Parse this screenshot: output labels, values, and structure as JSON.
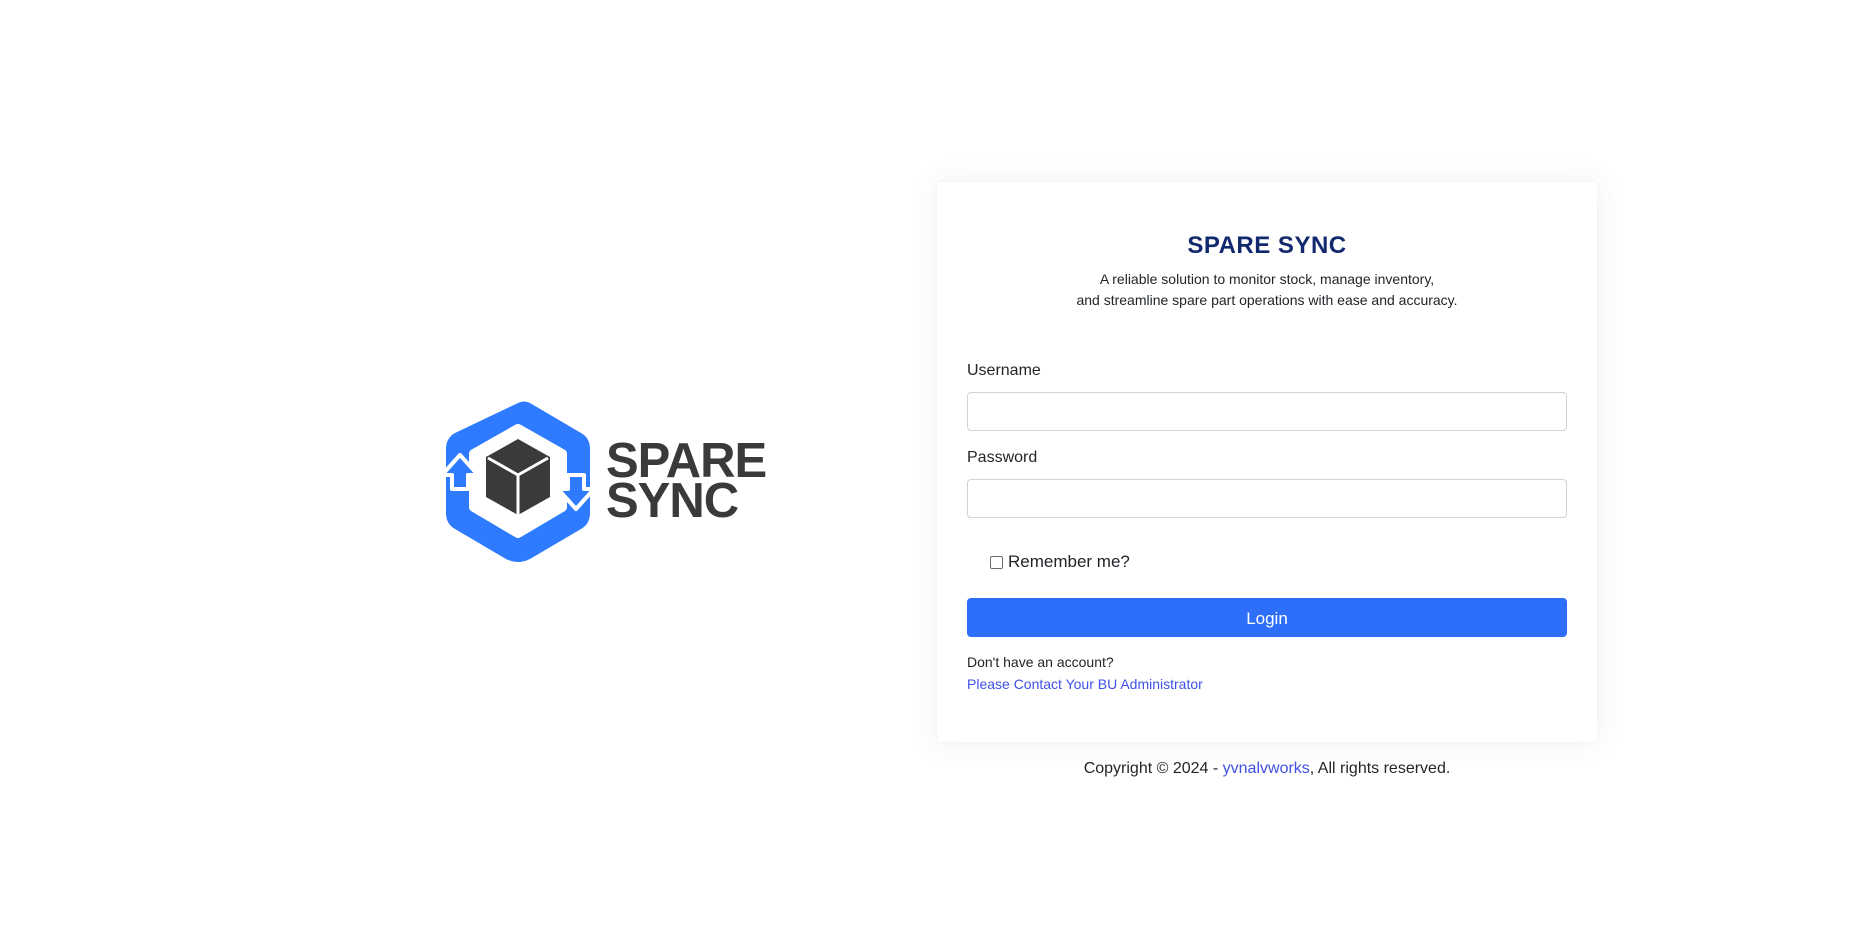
{
  "logo": {
    "line1": "SPARE",
    "line2": "SYNC",
    "icon": "box-sync-icon",
    "colors": {
      "hexagon": "#2e7bff",
      "box": "#3a3a3a",
      "text": "#3a3a3a"
    }
  },
  "card": {
    "title": "SPARE SYNC",
    "subtitle_line1": "A reliable solution to monitor stock, manage inventory,",
    "subtitle_line2": "and streamline spare part operations with ease and accuracy.",
    "username_label": "Username",
    "username_value": "",
    "password_label": "Password",
    "password_value": "",
    "remember_label": "Remember me?",
    "remember_checked": false,
    "login_label": "Login",
    "no_account_text": "Don't have an account?",
    "contact_link": "Please Contact Your BU Administrator"
  },
  "footer": {
    "prefix": "Copyright © 2024 - ",
    "link": "yvnalvworks",
    "suffix": ", All rights reserved."
  },
  "colors": {
    "accent": "#2e6ff9",
    "title": "#12296d",
    "link": "#3f51e6"
  }
}
